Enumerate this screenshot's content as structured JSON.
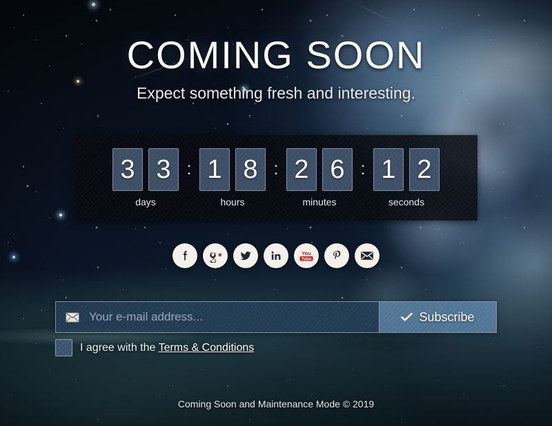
{
  "page": {
    "title": "COMING SOON",
    "subtitle": "Expect something fresh and interesting."
  },
  "countdown": {
    "separator": ":",
    "groups": [
      {
        "name": "days",
        "label": "days",
        "value": "33",
        "digits": [
          "3",
          "3"
        ]
      },
      {
        "name": "hours",
        "label": "hours",
        "value": "18",
        "digits": [
          "1",
          "8"
        ]
      },
      {
        "name": "minutes",
        "label": "minutes",
        "value": "26",
        "digits": [
          "2",
          "6"
        ]
      },
      {
        "name": "seconds",
        "label": "seconds",
        "value": "12",
        "digits": [
          "1",
          "2"
        ]
      }
    ]
  },
  "social": {
    "items": [
      {
        "icon": "facebook-icon",
        "label": "Facebook",
        "color": "#1d2b45"
      },
      {
        "icon": "google-plus-icon",
        "label": "Google Plus",
        "color": "#2b2b2b"
      },
      {
        "icon": "twitter-icon",
        "label": "Twitter",
        "color": "#1f2b3d"
      },
      {
        "icon": "linkedin-icon",
        "label": "LinkedIn",
        "color": "#1f3347"
      },
      {
        "icon": "youtube-icon",
        "label": "YouTube",
        "color": "#cc2424"
      },
      {
        "icon": "pinterest-icon",
        "label": "Pinterest",
        "color": "#2a2a2a"
      },
      {
        "icon": "email-icon",
        "label": "Email",
        "color": "#20242c"
      }
    ]
  },
  "subscribe": {
    "input_placeholder": "Your e-mail address...",
    "input_value": "",
    "input_icon": "envelope-icon",
    "button_label": "Subscribe",
    "button_icon": "check-icon"
  },
  "terms": {
    "checkbox_checked": false,
    "text_before": "I agree with the",
    "link_label": "Terms & Conditions"
  },
  "footer": {
    "text": "Coming Soon and Maintenance Mode © 2019"
  },
  "colors": {
    "accent": "#5c83a6",
    "panel": "#070c16",
    "digit_cell": "#4c627c",
    "text_light": "#ffffff"
  }
}
